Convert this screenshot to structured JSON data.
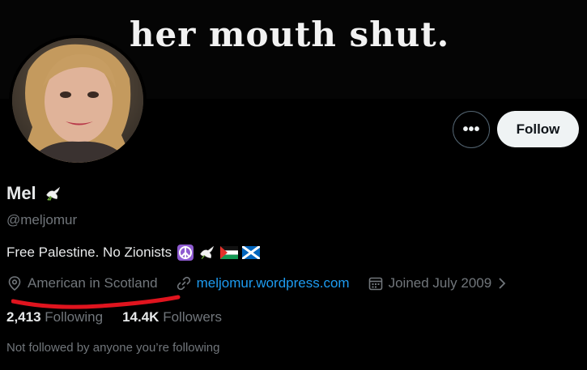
{
  "banner": {
    "text": "her mouth shut."
  },
  "profile": {
    "display_name": "Mel",
    "name_emoji": "dove-icon",
    "handle": "@meljomur",
    "bio_text": "Free Palestine. No Zionists",
    "bio_emojis": [
      "peace-symbol-icon",
      "dove-icon",
      "palestine-flag-icon",
      "scotland-flag-icon"
    ]
  },
  "actions": {
    "more": "•••",
    "follow": "Follow"
  },
  "meta": {
    "location": "American in Scotland",
    "website": "meljomur.wordpress.com",
    "joined": "Joined July 2009"
  },
  "stats": {
    "following_count": "2,413",
    "following_label": "Following",
    "followers_count": "14.4K",
    "followers_label": "Followers"
  },
  "followed_by": "Not followed by anyone you’re following",
  "colors": {
    "background": "#000000",
    "link": "#1d9bf0",
    "secondary_text": "#71767b",
    "annotation_underline": "#e0141e"
  }
}
